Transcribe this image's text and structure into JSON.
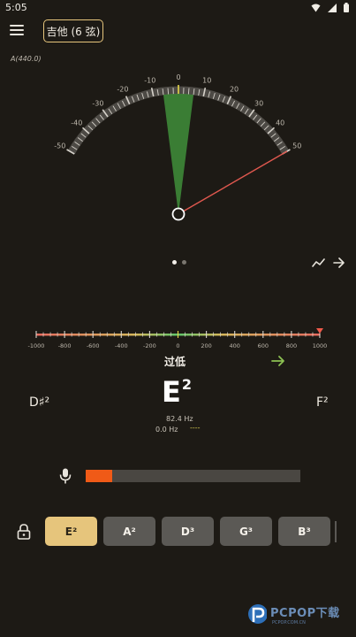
{
  "status_bar": {
    "time": "5:05"
  },
  "header": {
    "instrument": "吉他 (6 弦)",
    "reference": "A(440.0)"
  },
  "gauge": {
    "tick_labels": [
      "-50",
      "-40",
      "-30",
      "-20",
      "-10",
      "0",
      "10",
      "20",
      "30",
      "40",
      "50"
    ],
    "needle_value": 50,
    "target_band": [
      -6,
      6
    ]
  },
  "pager": {
    "count": 2,
    "active_index": 0
  },
  "scale": {
    "labels": [
      "-1000",
      "-800",
      "-600",
      "-400",
      "-200",
      "0",
      "200",
      "400",
      "600",
      "800",
      "1000"
    ],
    "marker_value": 1000
  },
  "tuning": {
    "status": "过低",
    "note": "E",
    "note_octave": "2",
    "prev_note": "D♯²",
    "next_note": "F²",
    "target_freq": "82.4 Hz",
    "current_freq": "0.0 Hz",
    "freq_dashes": "----"
  },
  "input_level": 0.125,
  "strings": [
    {
      "label": "E²",
      "selected": true
    },
    {
      "label": "A²",
      "selected": false
    },
    {
      "label": "D³",
      "selected": false
    },
    {
      "label": "G³",
      "selected": false
    },
    {
      "label": "B³",
      "selected": false
    }
  ],
  "watermark": {
    "brand": "PCPOP下载",
    "sub": "PCPOP.COM.CN"
  },
  "colors": {
    "background": "#1d1a15",
    "accent_gold": "#e6c57c",
    "needle_red": "#e0584f",
    "target_green": "#3f8f3a",
    "level_orange": "#f05a17",
    "status_arrow_green": "#8cc152"
  }
}
